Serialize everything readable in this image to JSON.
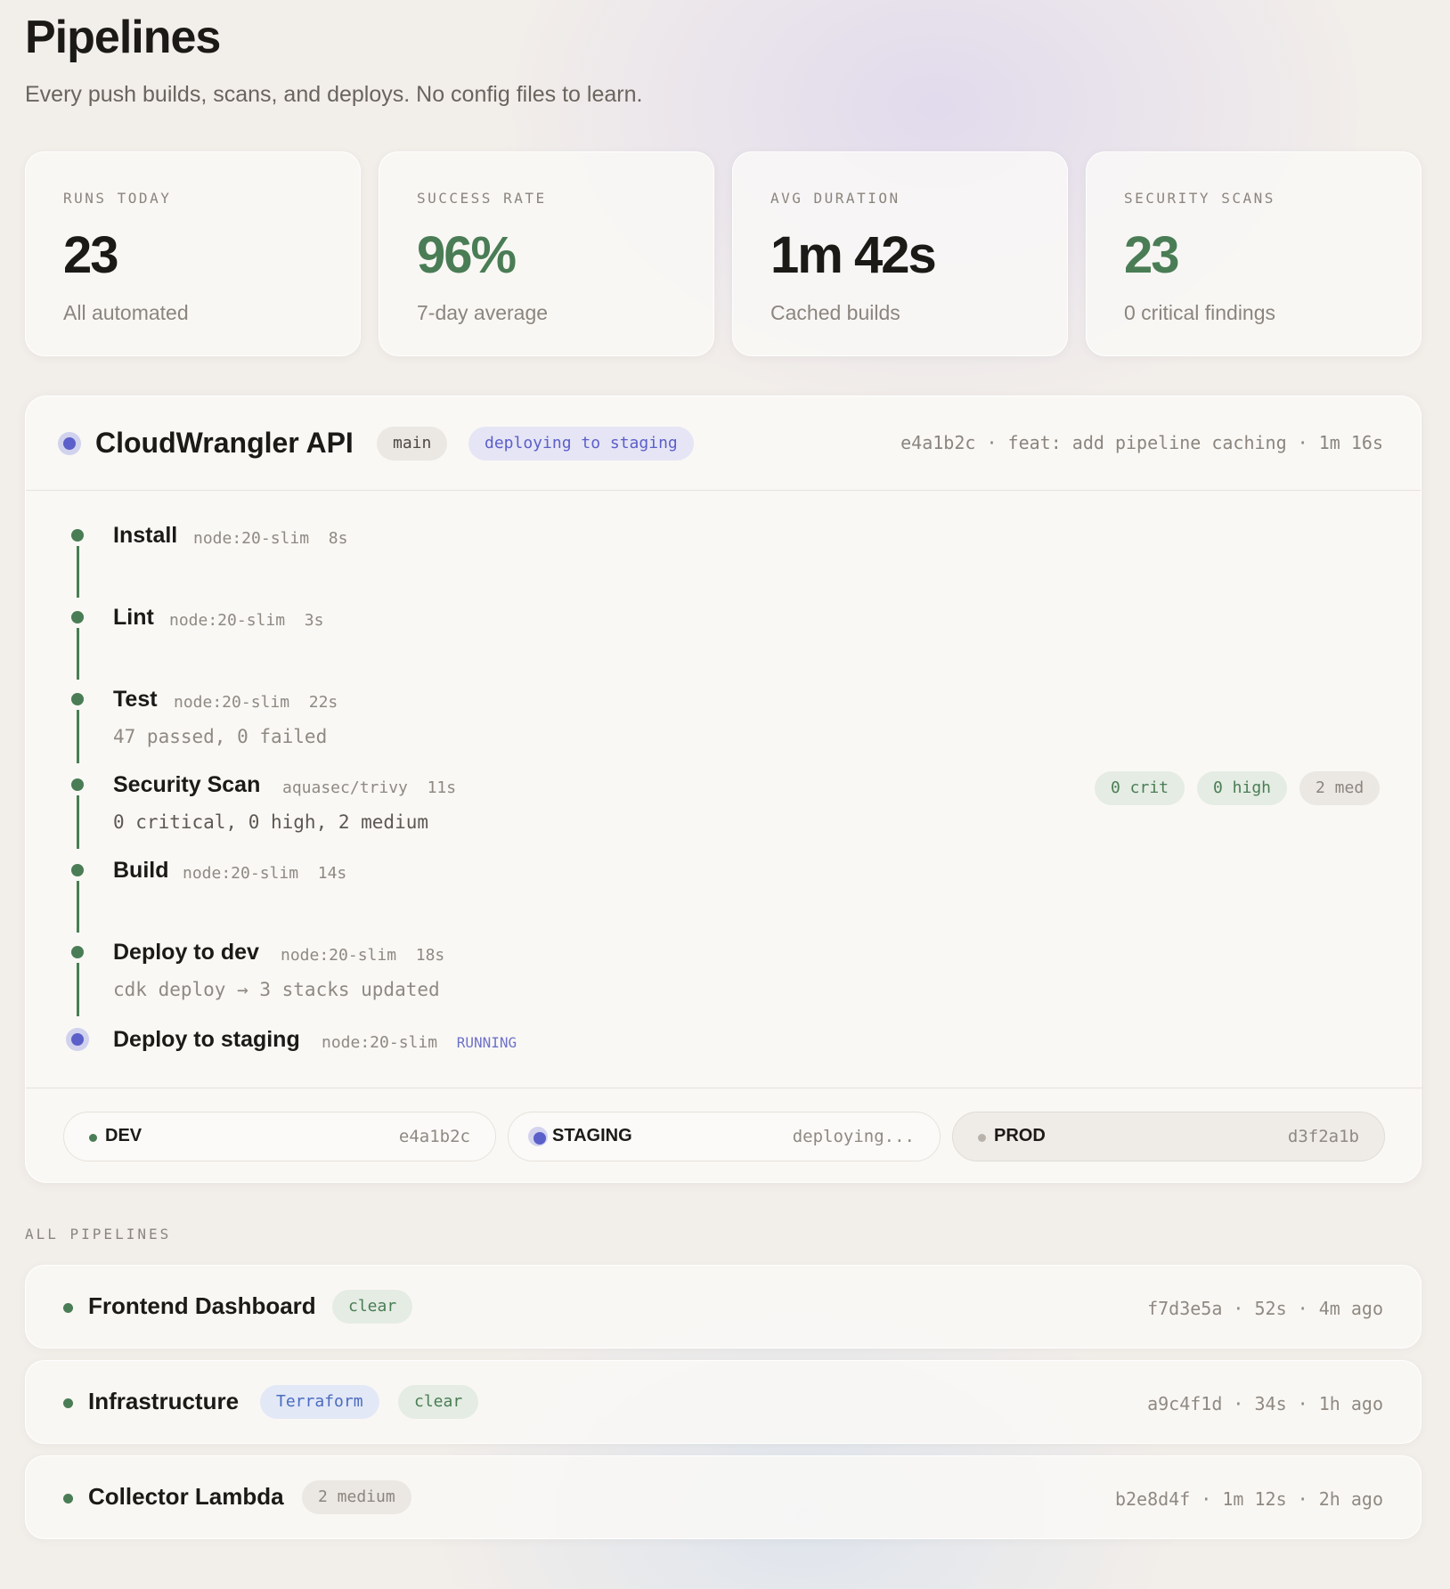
{
  "header": {
    "title": "Pipelines",
    "subtitle": "Every push builds, scans, and deploys. No config files to learn."
  },
  "stats": [
    {
      "label": "RUNS TODAY",
      "value": "23",
      "sub": "All automated"
    },
    {
      "label": "SUCCESS RATE",
      "value": "96%",
      "sub": "7-day average"
    },
    {
      "label": "AVG DURATION",
      "value": "1m 42s",
      "sub": "Cached builds"
    },
    {
      "label": "SECURITY SCANS",
      "value": "23",
      "sub": "0 critical findings"
    }
  ],
  "active_pipeline": {
    "name": "CloudWrangler API",
    "branch": "main",
    "status": "deploying to staging",
    "meta": "e4a1b2c · feat: add pipeline caching · 1m 16s",
    "steps": [
      {
        "name": "Install",
        "image": "node:20-slim",
        "duration": "8s"
      },
      {
        "name": "Lint",
        "image": "node:20-slim",
        "duration": "3s"
      },
      {
        "name": "Test",
        "image": "node:20-slim",
        "duration": "22s",
        "detail": "47 passed, 0 failed"
      },
      {
        "name": "Security Scan",
        "image": "aquasec/trivy",
        "duration": "11s",
        "detail": "0 critical, 0 high, 2 medium",
        "badges": [
          "0 crit",
          "0 high",
          "2 med"
        ]
      },
      {
        "name": "Build",
        "image": "node:20-slim",
        "duration": "14s"
      },
      {
        "name": "Deploy to dev",
        "image": "node:20-slim",
        "duration": "18s",
        "detail": "cdk deploy → 3 stacks updated"
      },
      {
        "name": "Deploy to staging",
        "image": "node:20-slim",
        "duration": "RUNNING"
      }
    ],
    "environments": [
      {
        "name": "DEV",
        "value": "e4a1b2c"
      },
      {
        "name": "STAGING",
        "value": "deploying..."
      },
      {
        "name": "PROD",
        "value": "d3f2a1b"
      }
    ]
  },
  "all_pipelines": {
    "label": "ALL PIPELINES",
    "rows": [
      {
        "name": "Frontend Dashboard",
        "tags": [
          "clear"
        ],
        "meta": "f7d3e5a · 52s · 4m ago"
      },
      {
        "name": "Infrastructure",
        "tags": [
          "Terraform",
          "clear"
        ],
        "meta": "a9c4f1d · 34s · 1h ago"
      },
      {
        "name": "Collector Lambda",
        "tags": [
          "2 medium"
        ],
        "meta": "b2e8d4f · 1m 12s · 2h ago"
      }
    ]
  },
  "colors": {
    "success": "#4a7d55",
    "running": "#5b5fc9",
    "info": "#4b6bc0"
  }
}
